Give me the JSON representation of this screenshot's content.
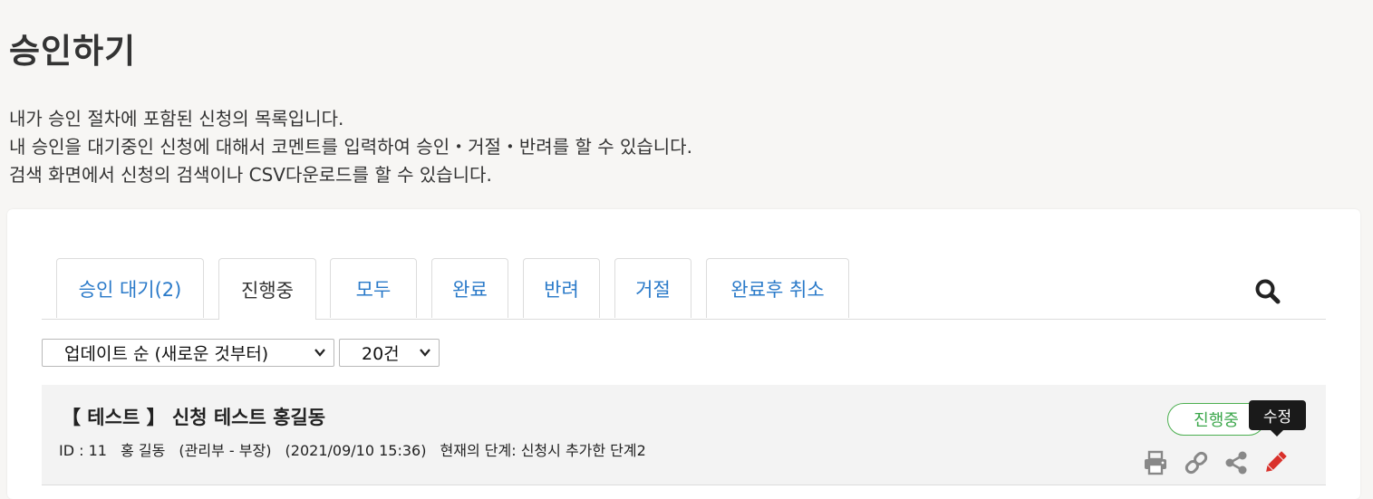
{
  "page": {
    "title": "승인하기",
    "description": [
      "내가 승인 절차에 포함된 신청의 목록입니다.",
      "내 승인을 대기중인 신청에 대해서 코멘트를 입력하여 승인・거절・반려를 할 수 있습니다.",
      "검색 화면에서 신청의 검색이나 CSV다운로드를 할 수 있습니다."
    ]
  },
  "tabs": [
    {
      "label": "승인 대기(2)",
      "active": false
    },
    {
      "label": "진행중",
      "active": true
    },
    {
      "label": "모두",
      "active": false
    },
    {
      "label": "완료",
      "active": false
    },
    {
      "label": "반려",
      "active": false
    },
    {
      "label": "거절",
      "active": false
    },
    {
      "label": "완료후 취소",
      "active": false
    }
  ],
  "search": {
    "icon": "search-icon"
  },
  "filters": {
    "sort_value": "업데이트 순 (새로운 것부터)",
    "count_value": "20건"
  },
  "items": [
    {
      "title": "【 테스트 】 신청 테스트 홍길동",
      "id_label": "ID : 11",
      "applicant": "홍 길동",
      "department": "(관리부 - 부장)",
      "datetime": "(2021/09/10 15:36)",
      "stage": "현재의 단계: 신청시 추가한 단계2",
      "status": "진행중"
    }
  ],
  "tooltip": {
    "text": "수정"
  },
  "actions": [
    {
      "name": "print-icon"
    },
    {
      "name": "link-icon"
    },
    {
      "name": "share-icon"
    },
    {
      "name": "edit-icon"
    }
  ],
  "colors": {
    "accent": "#2a7ac9",
    "status_green": "#3aa64a",
    "edit_red": "#d9302a",
    "icon_gray": "#888888"
  }
}
